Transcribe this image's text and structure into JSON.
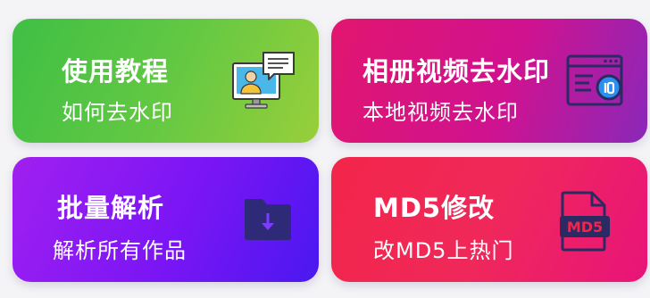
{
  "cards": [
    {
      "title": "使用教程",
      "subtitle": "如何去水印",
      "icon": "video-tutorial-icon"
    },
    {
      "title": "相册视频去水印",
      "subtitle": "本地视频去水印",
      "icon": "album-window-icon"
    },
    {
      "title": "批量解析",
      "subtitle": "解析所有作品",
      "icon": "folder-download-icon"
    },
    {
      "title": "MD5修改",
      "subtitle": "改MD5上热门",
      "icon": "md5-file-icon"
    }
  ],
  "colors": {
    "card1": "#5cc544",
    "card2": "#d8147e",
    "card3": "#7a15f5",
    "card4": "#f0264f",
    "icon_dark": "#2b2a63",
    "icon_navy": "#2e2a78"
  }
}
